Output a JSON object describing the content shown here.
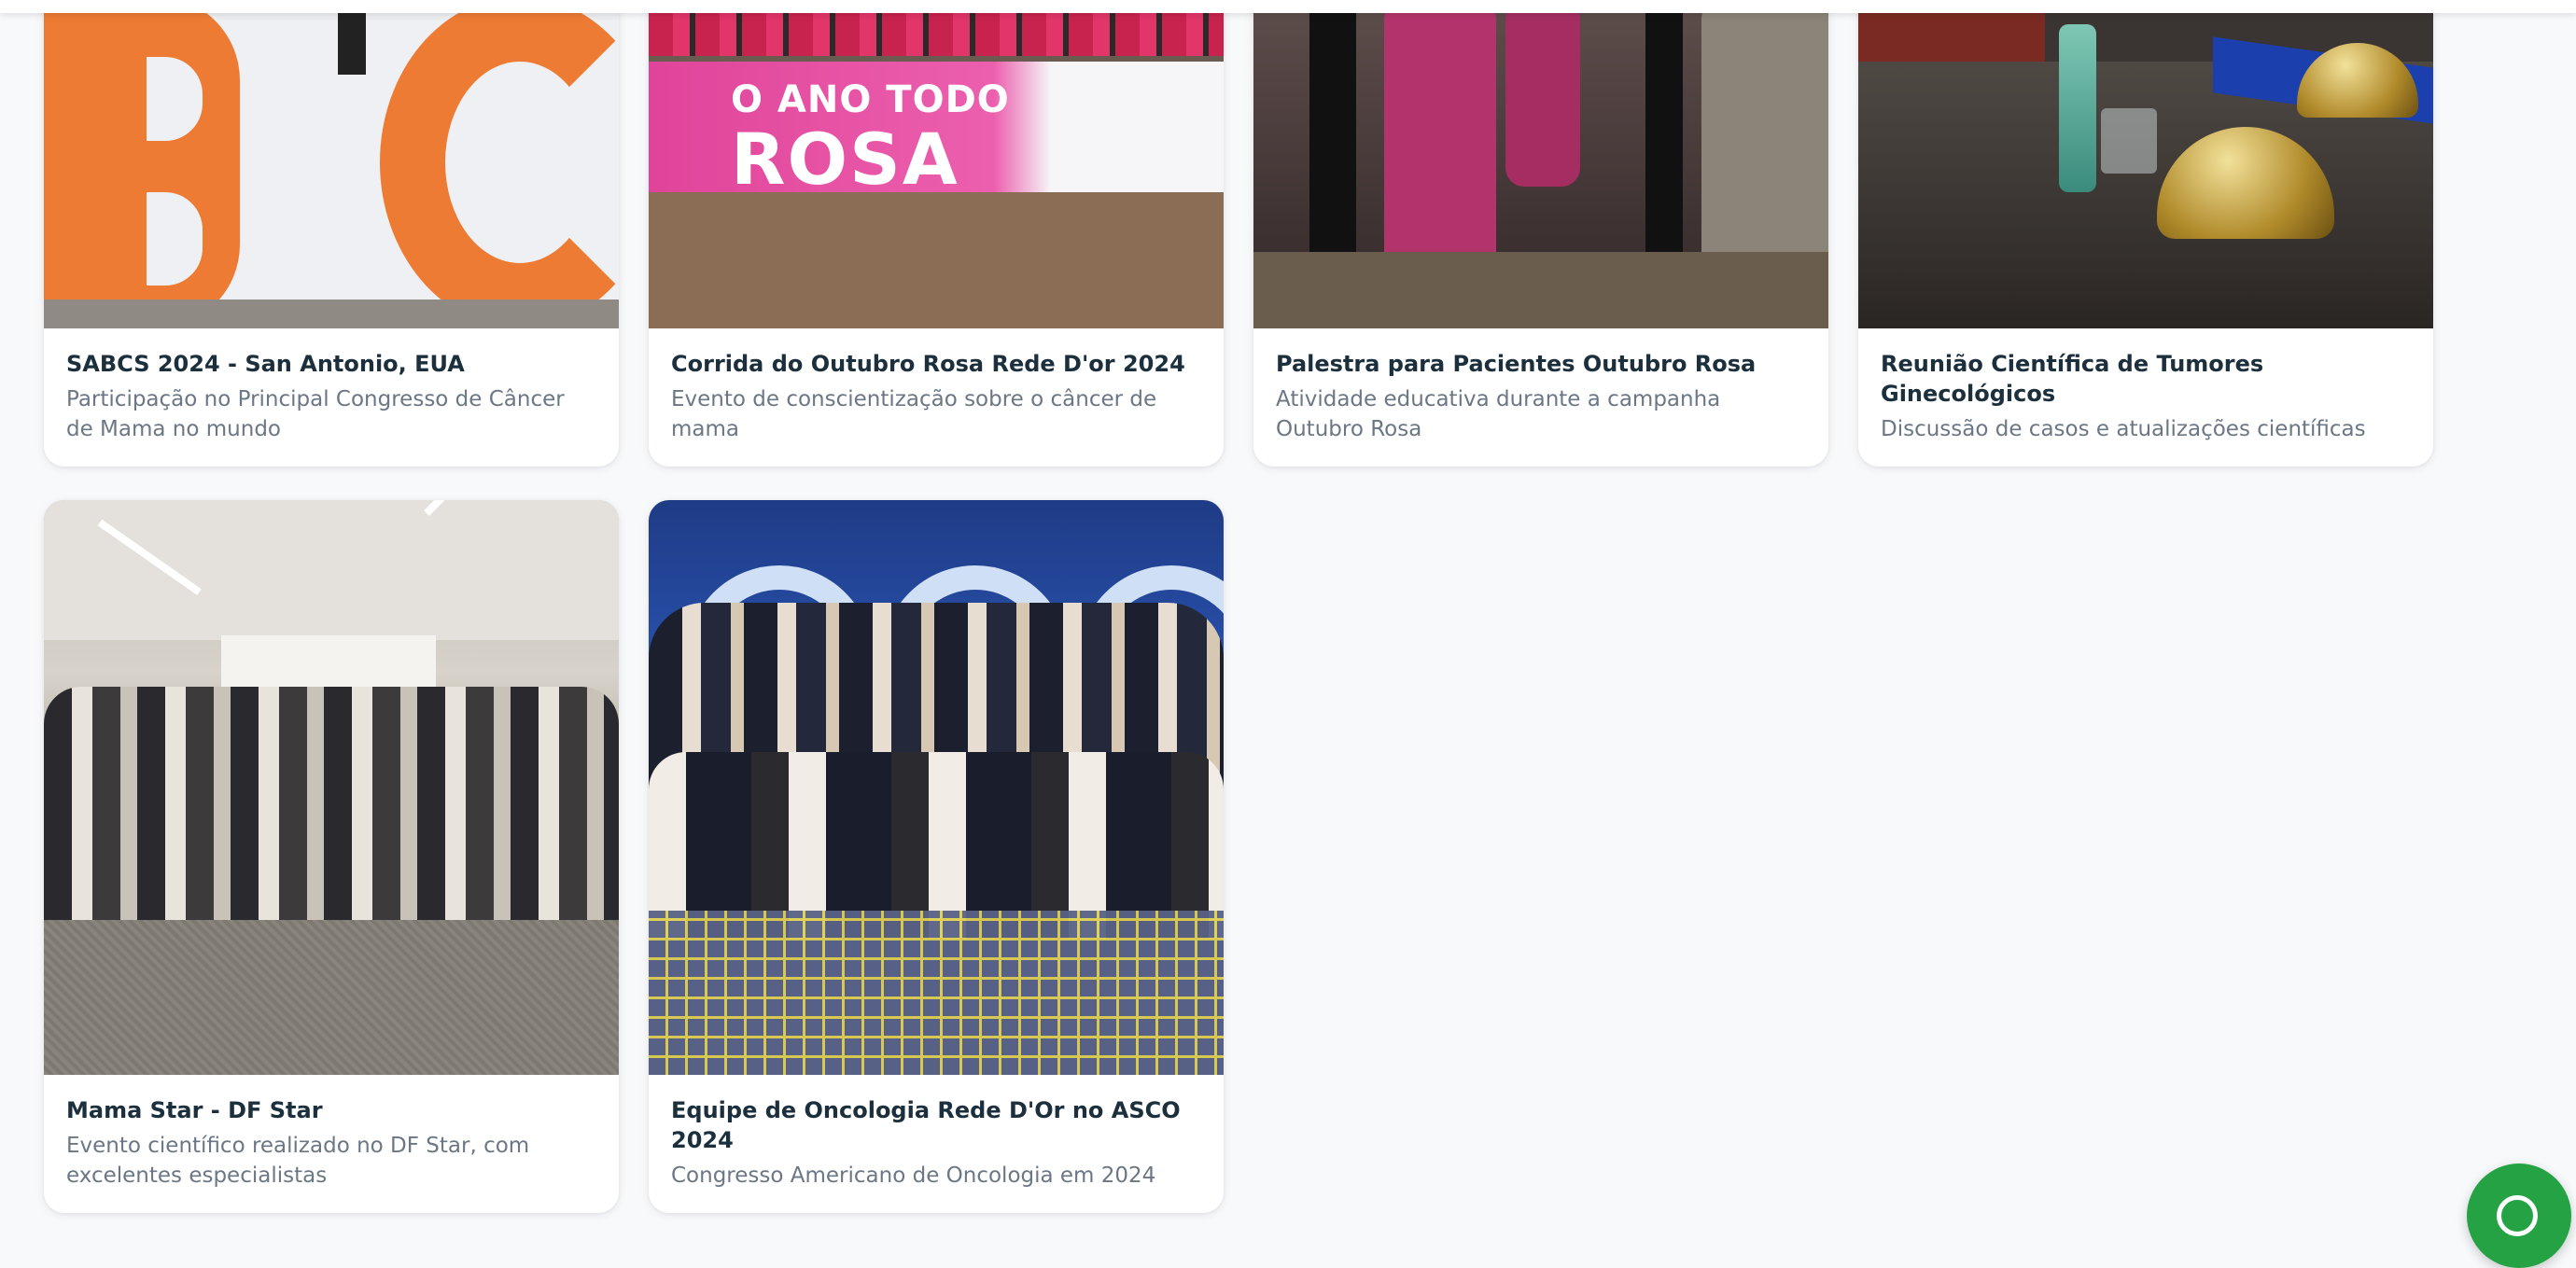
{
  "gallery": {
    "cards": [
      {
        "title": "SABCS 2024 - San Antonio, EUA",
        "description": "Participação no Principal Congresso de Câncer de Mama no mundo"
      },
      {
        "title": "Corrida do Outubro Rosa Rede D'or 2024",
        "description": "Evento de conscientização sobre o câncer de mama",
        "banner_line1": "O ANO TODO",
        "banner_line2": "ROSA"
      },
      {
        "title": "Palestra para Pacientes Outubro Rosa",
        "description": "Atividade educativa durante a campanha Outubro Rosa"
      },
      {
        "title": "Reunião Científica de Tumores Ginecológicos",
        "description": "Discussão de casos e atualizações científicas"
      },
      {
        "title": "Mama Star - DF Star",
        "description": "Evento científico realizado no DF Star, com excelentes especialistas"
      },
      {
        "title": "Equipe de Oncologia Rede D'Or no ASCO 2024",
        "description": "Congresso Americano de Oncologia em 2024"
      }
    ]
  },
  "chat_fab": {
    "icon": "chat-bubble-icon",
    "color": "#25a244"
  }
}
